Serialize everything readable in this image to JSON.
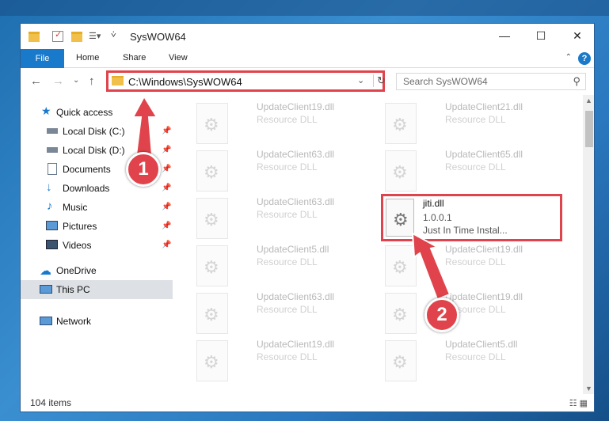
{
  "window": {
    "title": "SysWOW64",
    "minimize": "—",
    "maximize": "☐",
    "close": "✕"
  },
  "ribbon": {
    "file": "File",
    "home": "Home",
    "share": "Share",
    "view": "View",
    "help": "?"
  },
  "address": {
    "path": "C:\\Windows\\SysWOW64"
  },
  "search": {
    "placeholder": "Search SysWOW64"
  },
  "sidebar": {
    "items": [
      {
        "label": "Quick access"
      },
      {
        "label": "Local Disk (C:)"
      },
      {
        "label": "Local Disk (D:)"
      },
      {
        "label": "Documents"
      },
      {
        "label": "Downloads"
      },
      {
        "label": "Music"
      },
      {
        "label": "Pictures"
      },
      {
        "label": "Videos"
      },
      {
        "label": "OneDrive"
      },
      {
        "label": "This PC"
      },
      {
        "label": "Network"
      }
    ]
  },
  "files": [
    {
      "name": "UpdateClient19.dll",
      "desc": "Resource DLL"
    },
    {
      "name": "UpdateClient21.dll",
      "desc": "Resource DLL"
    },
    {
      "name": "UpdateClient63.dll",
      "desc": "Resource DLL"
    },
    {
      "name": "UpdateClient65.dll",
      "desc": "Resource DLL"
    },
    {
      "name": "UpdateClient63.dll",
      "desc": "Resource DLL"
    },
    {
      "name": "UpdateClient5.dll",
      "desc": "Resource DLL"
    },
    {
      "name": "UpdateClient19.dll",
      "desc": "Resource DLL"
    },
    {
      "name": "UpdateClient63.dll",
      "desc": "Resource DLL"
    },
    {
      "name": "UpdateClient19.dll",
      "desc": "Resource DLL"
    },
    {
      "name": "UpdateClient19.dll",
      "desc": "Resource DLL"
    },
    {
      "name": "UpdateClient5.dll",
      "desc": "Resource DLL"
    }
  ],
  "highlighted_file": {
    "name": "jiti.dll",
    "version": "1.0.0.1",
    "desc": "Just In Time Instal..."
  },
  "status": {
    "count": "104 items"
  },
  "annotations": {
    "marker1": "1",
    "marker2": "2",
    "color": "#e0434b"
  }
}
